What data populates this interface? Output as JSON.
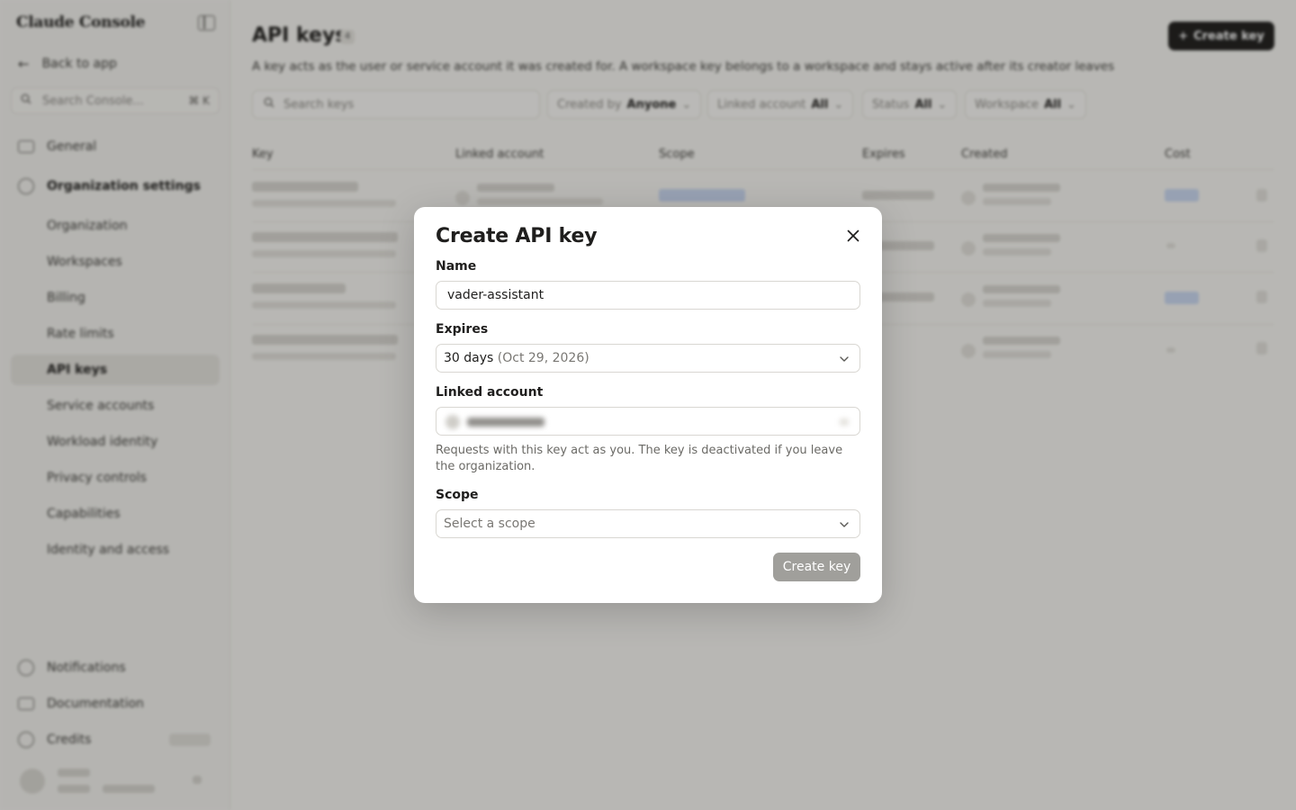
{
  "sidebar": {
    "logo": "Claude Console",
    "back_label": "Back to app",
    "search_placeholder": "Search Console...",
    "search_shortcut": "⌘ K",
    "items": [
      {
        "label": "General"
      },
      {
        "label": "Organization settings"
      },
      {
        "label": "Organization"
      },
      {
        "label": "Workspaces"
      },
      {
        "label": "Billing"
      },
      {
        "label": "Rate limits"
      },
      {
        "label": "API keys"
      },
      {
        "label": "Service accounts"
      },
      {
        "label": "Workload identity"
      },
      {
        "label": "Privacy controls"
      },
      {
        "label": "Capabilities"
      },
      {
        "label": "Identity and access"
      }
    ],
    "bottom": [
      {
        "label": "Notifications"
      },
      {
        "label": "Documentation"
      },
      {
        "label": "Credits"
      }
    ]
  },
  "main": {
    "title": "API keys",
    "title_badge": "4",
    "create_label": "Create key",
    "description": "A key acts as the user or service account it was created for. A workspace key belongs to a workspace and stays active after its creator leaves",
    "search_placeholder": "Search keys",
    "filters": [
      {
        "label": "Created by",
        "value": "Anyone"
      },
      {
        "label": "Linked account",
        "value": "All"
      },
      {
        "label": "Status",
        "value": "All"
      },
      {
        "label": "Workspace",
        "value": "All"
      }
    ],
    "columns": [
      "Key",
      "Linked account",
      "Scope",
      "Expires",
      "Created",
      "Cost"
    ]
  },
  "modal": {
    "title": "Create API key",
    "name_label": "Name",
    "name_value": "vader-assistant",
    "expires_label": "Expires",
    "expires_value": "30 days",
    "expires_date": "(Oct 29, 2026)",
    "linked_label": "Linked account",
    "helper_text": "Requests with this key act as you. The key is deactivated if you leave the organization.",
    "scope_label": "Scope",
    "scope_placeholder": "Select a scope",
    "create_label": "Create key"
  }
}
